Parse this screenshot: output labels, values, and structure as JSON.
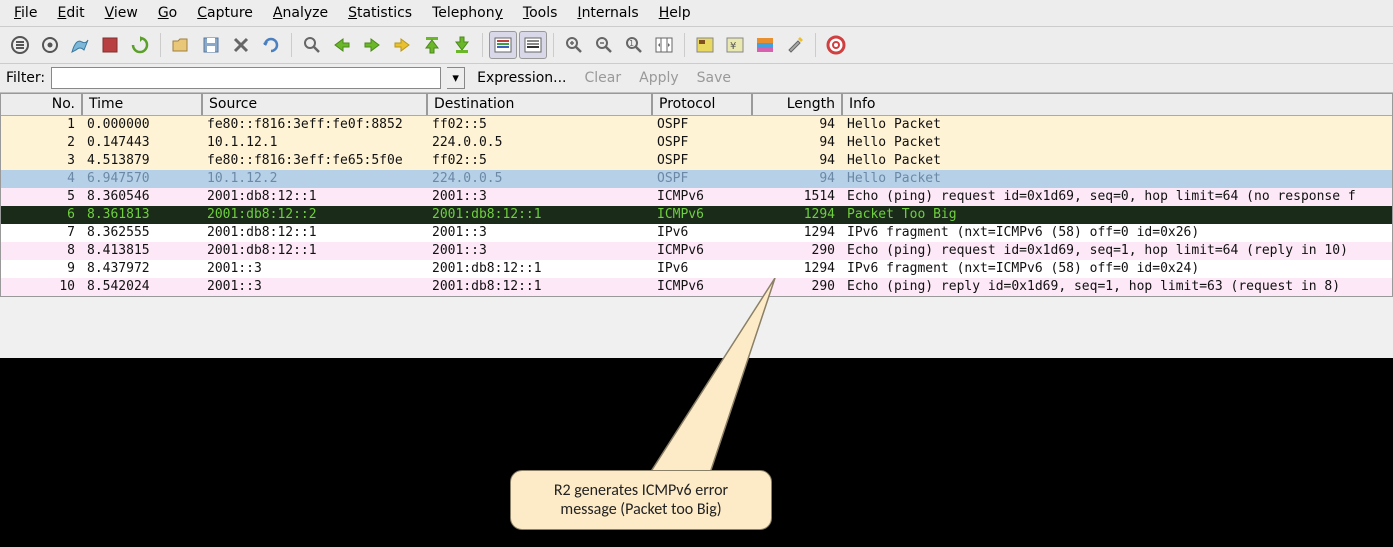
{
  "menu": {
    "file": "File",
    "edit": "Edit",
    "view": "View",
    "go": "Go",
    "capture": "Capture",
    "analyze": "Analyze",
    "statistics": "Statistics",
    "telephony": "Telephony",
    "tools": "Tools",
    "internals": "Internals",
    "help": "Help"
  },
  "filter": {
    "label": "Filter:",
    "value": "",
    "expression": "Expression...",
    "clear": "Clear",
    "apply": "Apply",
    "save": "Save"
  },
  "columns": {
    "no": "No.",
    "time": "Time",
    "source": "Source",
    "destination": "Destination",
    "protocol": "Protocol",
    "length": "Length",
    "info": "Info"
  },
  "rows": [
    {
      "no": "1",
      "time": "0.000000",
      "src": "fe80::f816:3eff:fe0f:8852",
      "dst": "ff02::5",
      "proto": "OSPF",
      "len": "94",
      "info": "Hello Packet",
      "cls": "row-ospf"
    },
    {
      "no": "2",
      "time": "0.147443",
      "src": "10.1.12.1",
      "dst": "224.0.0.5",
      "proto": "OSPF",
      "len": "94",
      "info": "Hello Packet",
      "cls": "row-ospf"
    },
    {
      "no": "3",
      "time": "4.513879",
      "src": "fe80::f816:3eff:fe65:5f0e",
      "dst": "ff02::5",
      "proto": "OSPF",
      "len": "94",
      "info": "Hello Packet",
      "cls": "row-ospf"
    },
    {
      "no": "4",
      "time": "6.947570",
      "src": "10.1.12.2",
      "dst": "224.0.0.5",
      "proto": "OSPF",
      "len": "94",
      "info": "Hello Packet",
      "cls": "row-sel"
    },
    {
      "no": "5",
      "time": "8.360546",
      "src": "2001:db8:12::1",
      "dst": "2001::3",
      "proto": "ICMPv6",
      "len": "1514",
      "info": "Echo (ping) request id=0x1d69, seq=0, hop limit=64 (no response f",
      "cls": "row-icmp"
    },
    {
      "no": "6",
      "time": "8.361813",
      "src": "2001:db8:12::2",
      "dst": "2001:db8:12::1",
      "proto": "ICMPv6",
      "len": "1294",
      "info": "Packet Too Big",
      "cls": "row-dark"
    },
    {
      "no": "7",
      "time": "8.362555",
      "src": "2001:db8:12::1",
      "dst": "2001::3",
      "proto": "IPv6",
      "len": "1294",
      "info": "IPv6 fragment (nxt=ICMPv6 (58) off=0 id=0x26)",
      "cls": "row-ipv6"
    },
    {
      "no": "8",
      "time": "8.413815",
      "src": "2001:db8:12::1",
      "dst": "2001::3",
      "proto": "ICMPv6",
      "len": "290",
      "info": "Echo (ping) request id=0x1d69, seq=1, hop limit=64 (reply in 10)",
      "cls": "row-icmp"
    },
    {
      "no": "9",
      "time": "8.437972",
      "src": "2001::3",
      "dst": "2001:db8:12::1",
      "proto": "IPv6",
      "len": "1294",
      "info": "IPv6 fragment (nxt=ICMPv6 (58) off=0 id=0x24)",
      "cls": "row-ipv6"
    },
    {
      "no": "10",
      "time": "8.542024",
      "src": "2001::3",
      "dst": "2001:db8:12::1",
      "proto": "ICMPv6",
      "len": "290",
      "info": "Echo (ping) reply id=0x1d69, seq=1, hop limit=63 (request in 8)",
      "cls": "row-icmp"
    }
  ],
  "callout": {
    "text": "R2 generates ICMPv6 error message (Packet too Big)"
  },
  "icons": {
    "list": "list-icon",
    "gear": "gear-icon",
    "fin": "fin-icon",
    "stop": "stop-icon",
    "restart": "restart-icon",
    "open": "open-icon",
    "save": "save-icon",
    "close": "close-icon",
    "reload": "reload-icon",
    "find": "find-icon",
    "back": "back-icon",
    "fwd": "forward-icon",
    "jump": "jump-icon",
    "top": "top-icon",
    "bottom": "bottom-icon",
    "colorize": "colorize-icon",
    "autoscroll": "autoscroll-icon",
    "zoomin": "zoom-in-icon",
    "zoomout": "zoom-out-icon",
    "zoom1": "zoom-reset-icon",
    "resize": "resize-cols-icon",
    "capfilt": "capture-filters-icon",
    "dispfilt": "display-filters-icon",
    "coloring": "coloring-rules-icon",
    "prefs": "preferences-icon",
    "help": "help-icon"
  }
}
